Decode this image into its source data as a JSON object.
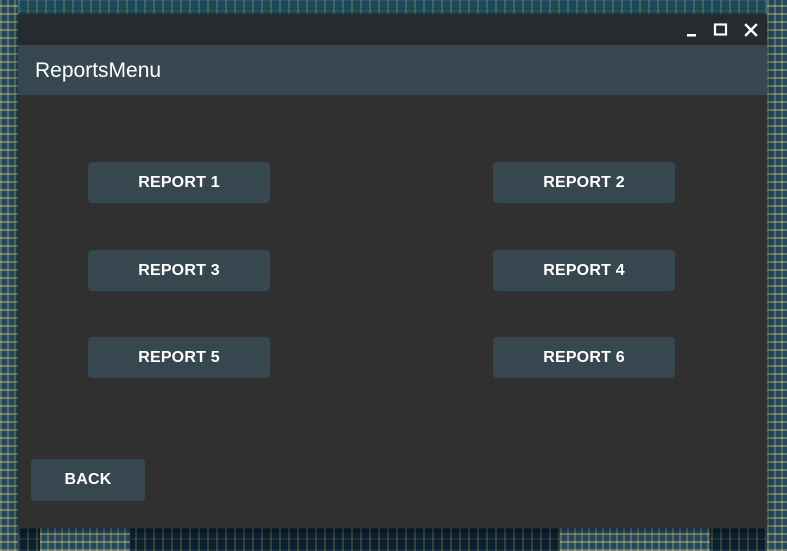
{
  "window": {
    "title": "ReportsMenu",
    "controls": {
      "minimize_icon": "minimize-icon",
      "maximize_icon": "maximize-icon",
      "close_icon": "close-icon"
    }
  },
  "reports": [
    {
      "label": "REPORT 1"
    },
    {
      "label": "REPORT 2"
    },
    {
      "label": "REPORT 3"
    },
    {
      "label": "REPORT 4"
    },
    {
      "label": "REPORT 5"
    },
    {
      "label": "REPORT 6"
    }
  ],
  "back": {
    "label": "BACK"
  },
  "colors": {
    "window_background": "#303030",
    "titlebar": "#262b30",
    "header": "#37474f",
    "button": "#37474f",
    "text": "#ffffff"
  }
}
